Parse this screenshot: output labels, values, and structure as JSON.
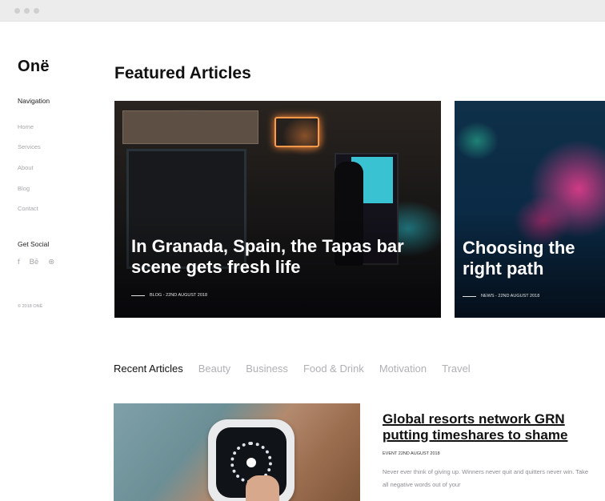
{
  "sidebar": {
    "logo": "Onë",
    "nav_heading": "Navigation",
    "nav_items": [
      "Home",
      "Services",
      "About",
      "Blog",
      "Contact"
    ],
    "social_heading": "Get Social",
    "social_icons": [
      {
        "name": "facebook-icon",
        "glyph": "f"
      },
      {
        "name": "behance-icon",
        "glyph": "Bē"
      },
      {
        "name": "dribbble-icon",
        "glyph": "⊛"
      }
    ],
    "copyright": "© 2018 ONË"
  },
  "featured": {
    "title": "Featured Articles",
    "cards": [
      {
        "title": "In Granada, Spain, the Tapas bar scene gets fresh life",
        "meta": "BLOG - 22ND AUGUST 2018"
      },
      {
        "title": "Choosing the right path",
        "meta": "NEWS - 22ND AUGUST 2018"
      }
    ]
  },
  "recent": {
    "tabs": [
      "Recent Articles",
      "Beauty",
      "Business",
      "Food & Drink",
      "Motivation",
      "Travel"
    ],
    "active_tab": "Recent Articles",
    "article": {
      "title": "Global resorts network GRN putting timeshares to shame",
      "meta": "EVENT 22ND AUGUST 2018",
      "excerpt": "Never ever think of giving up. Winners never quit and quitters never win. Take all negative words out of your"
    }
  }
}
